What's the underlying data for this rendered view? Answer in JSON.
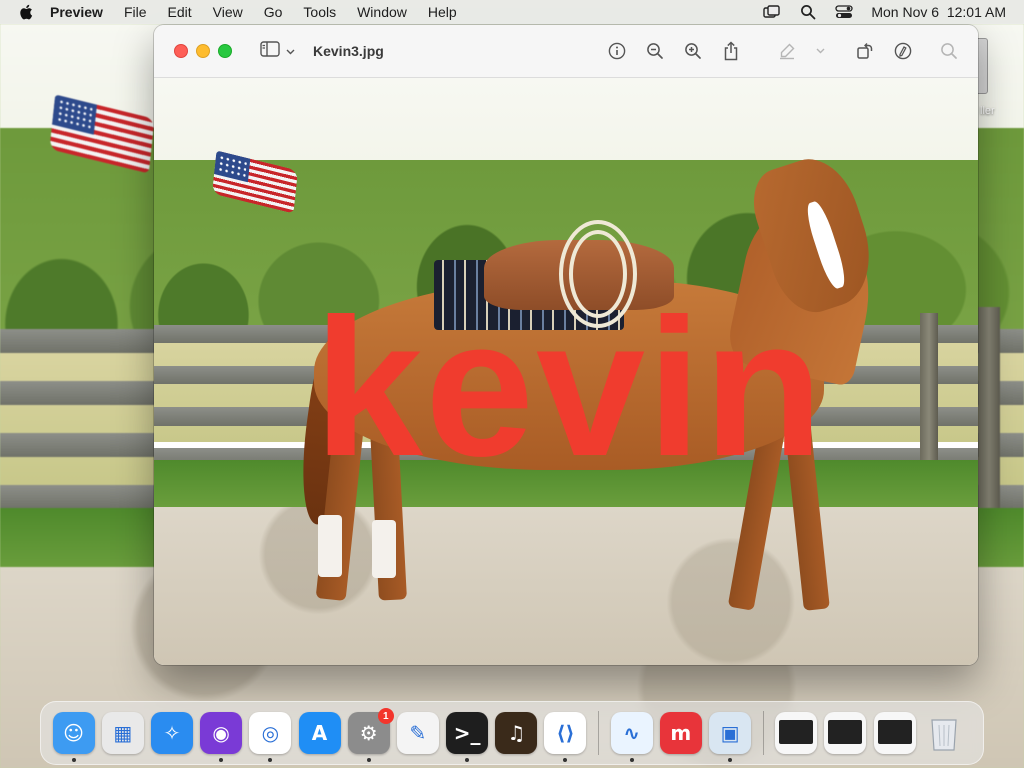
{
  "menubar": {
    "apple_icon": "apple-logo-icon",
    "app_name": "Preview",
    "items": [
      "File",
      "Edit",
      "View",
      "Go",
      "Tools",
      "Window",
      "Help"
    ],
    "datetime": "Mon Nov 6  12:01 AM",
    "status_icons": [
      "screen-mirroring-icon",
      "spotlight-search-icon",
      "control-center-icon"
    ]
  },
  "window": {
    "title": "Kevin3.jpg",
    "toolbar_icons": [
      "sidebar-toggle-icon",
      "info-icon",
      "zoom-out-icon",
      "zoom-in-icon",
      "share-icon",
      "highlight-icon",
      "highlight-menu-chevron-icon",
      "rotate-icon",
      "markup-icon",
      "search-icon"
    ]
  },
  "image": {
    "overlay_text": "kevin",
    "overlay_color": "#f03c2e"
  },
  "desktop": {
    "partial_label": "ller"
  },
  "dock": {
    "apps": [
      {
        "name": "Finder",
        "icon": "finder-icon",
        "running": true,
        "color": "#3d9bf2"
      },
      {
        "name": "Launchpad",
        "icon": "launchpad-icon",
        "running": false,
        "color": "#e9e9e9"
      },
      {
        "name": "Safari",
        "icon": "safari-icon",
        "running": false,
        "color": "#2a8cf0"
      },
      {
        "name": "Firefox",
        "icon": "firefox-icon",
        "running": true,
        "color": "#7a3ad6"
      },
      {
        "name": "Chrome",
        "icon": "chrome-icon",
        "running": true,
        "color": "#ffffff"
      },
      {
        "name": "App Store",
        "icon": "app-store-icon",
        "running": false,
        "color": "#1f8ef5"
      },
      {
        "name": "System Preferences",
        "icon": "system-preferences-icon",
        "running": true,
        "badge": "1",
        "color": "#8c8c8c"
      },
      {
        "name": "TextEdit",
        "icon": "textedit-icon",
        "running": false,
        "color": "#f4f4f4"
      },
      {
        "name": "Terminal",
        "icon": "terminal-icon",
        "running": true,
        "color": "#1e1e1e"
      },
      {
        "name": "GarageBand",
        "icon": "garageband-icon",
        "running": false,
        "color": "#3a2a1a"
      },
      {
        "name": "Visual Studio Code",
        "icon": "vscode-icon",
        "running": true,
        "color": "#ffffff"
      },
      {
        "name": "Freeform",
        "icon": "freeform-icon",
        "running": true,
        "color": "#eaf4ff"
      },
      {
        "name": "Mela",
        "icon": "mela-icon",
        "running": false,
        "color": "#e8343a"
      },
      {
        "name": "Preview",
        "icon": "preview-icon",
        "running": true,
        "color": "#d9e6f2"
      }
    ],
    "recents": [
      {
        "name": "Recent window 1",
        "icon": "recent-vscode-window-icon"
      },
      {
        "name": "Recent window 2",
        "icon": "recent-settings-window-icon"
      },
      {
        "name": "Recent window 3",
        "icon": "recent-garageband-window-icon"
      }
    ],
    "trash_icon": "trash-icon"
  }
}
